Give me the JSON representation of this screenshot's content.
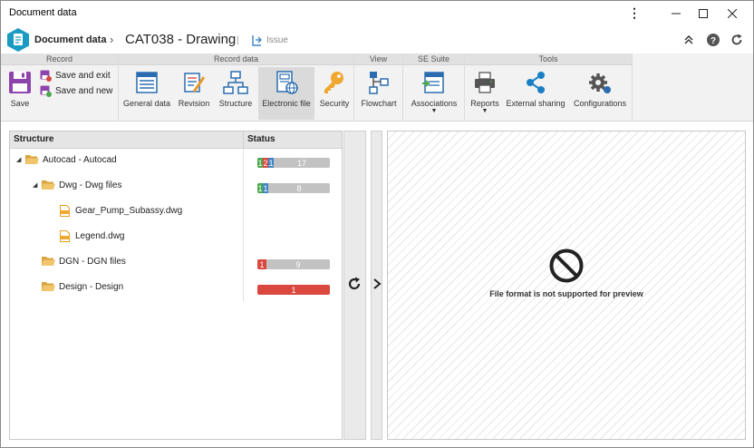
{
  "window": {
    "title": "Document data"
  },
  "header": {
    "app_name": "Document data",
    "doc_title": "CAT038 - Drawing",
    "issue_label": "Issue"
  },
  "ribbon": {
    "groups": {
      "record": "Record",
      "record_data": "Record data",
      "view": "View",
      "se_suite": "SE Suite",
      "tools": "Tools"
    },
    "buttons": {
      "save": "Save",
      "save_and_exit": "Save and exit",
      "save_and_new": "Save and new",
      "general_data": "General data",
      "revision": "Revision",
      "structure": "Structure",
      "electronic_file": "Electronic file",
      "security": "Security",
      "flowchart": "Flowchart",
      "associations": "Associations",
      "reports": "Reports",
      "external_sharing": "External sharing",
      "configurations": "Configurations"
    }
  },
  "structure": {
    "columns": {
      "name": "Structure",
      "status": "Status"
    },
    "rows": [
      {
        "name": "Autocad - Autocad",
        "status": [
          "1",
          "2",
          "1",
          "17"
        ]
      },
      {
        "name": "Dwg - Dwg files",
        "status": [
          "1",
          "1",
          "8"
        ]
      },
      {
        "name": "Gear_Pump_Subassy.dwg"
      },
      {
        "name": "Legend.dwg"
      },
      {
        "name": "DGN - DGN files",
        "status": [
          "1",
          "9"
        ]
      },
      {
        "name": "Design - Design",
        "status": [
          "1"
        ]
      }
    ]
  },
  "preview": {
    "message": "File format is not supported for preview"
  }
}
